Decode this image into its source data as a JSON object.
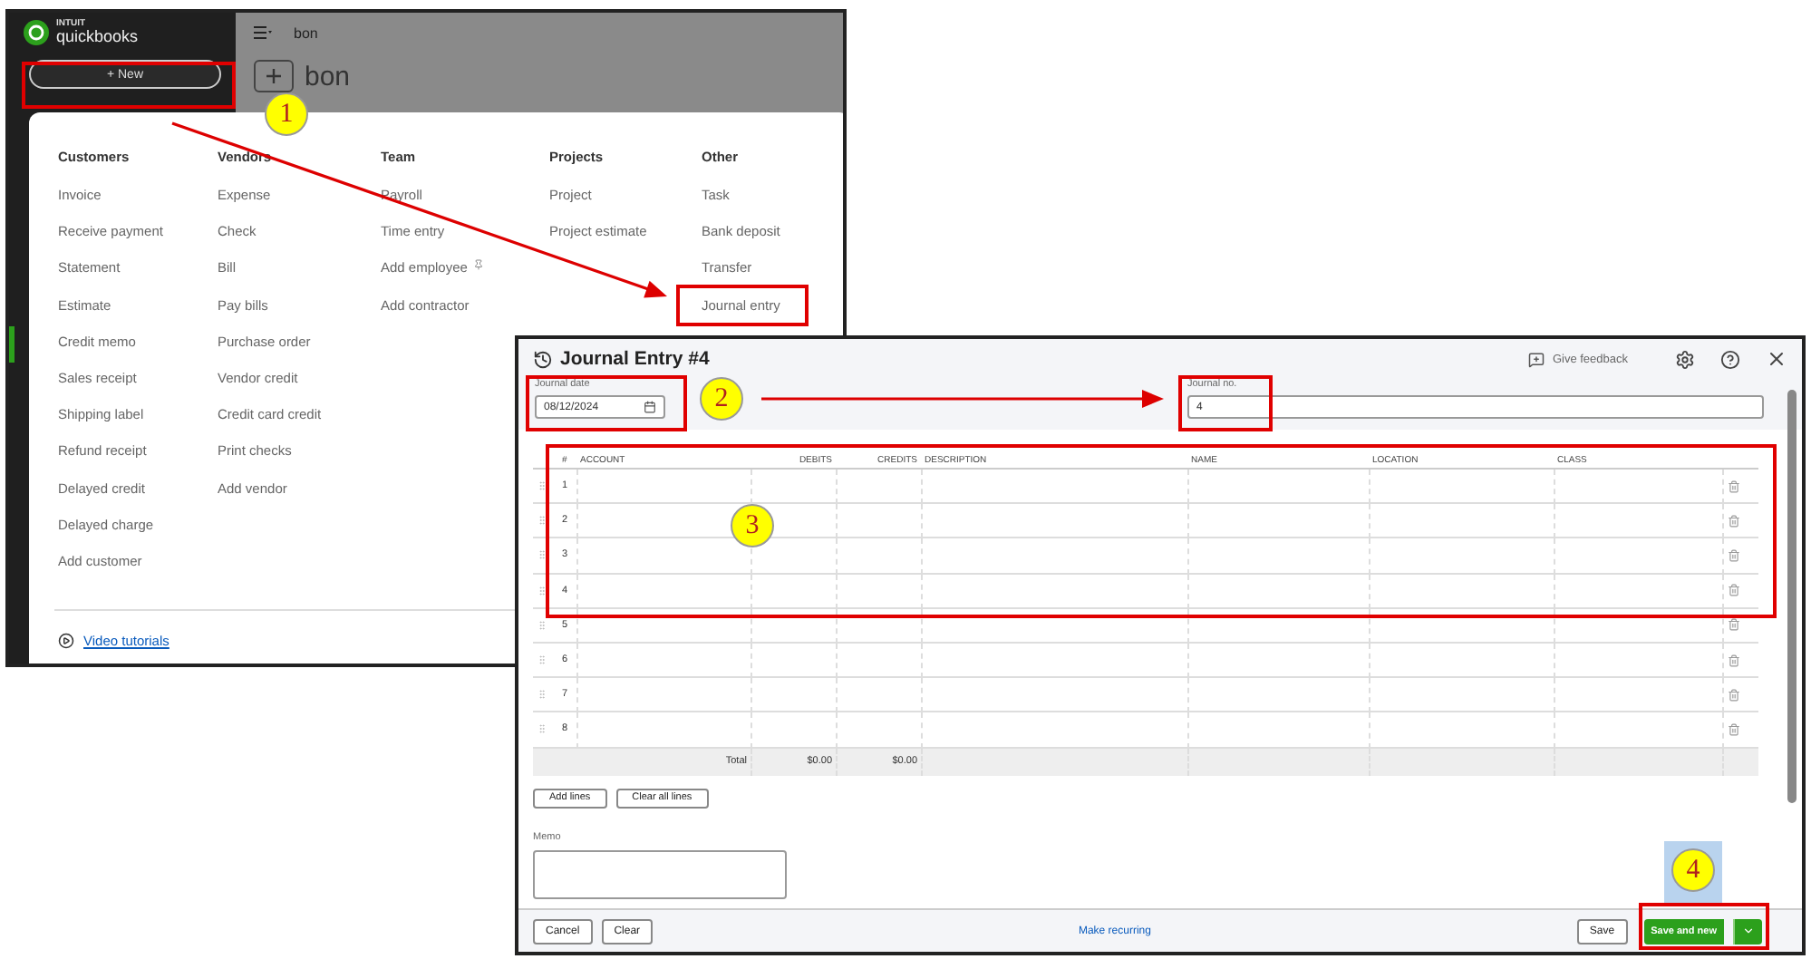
{
  "quickbooks_window": {
    "brand_small": "INTUIT",
    "brand": "quickbooks",
    "new_button": "+ New",
    "topbar_title": "bon",
    "page_title": "bon",
    "menu": {
      "columns": [
        {
          "heading": "Customers",
          "items": [
            "Invoice",
            "Receive payment",
            "Statement",
            "Estimate",
            "Credit memo",
            "Sales receipt",
            "Shipping label",
            "Refund receipt",
            "Delayed credit",
            "Delayed charge",
            "Add customer"
          ]
        },
        {
          "heading": "Vendors",
          "items": [
            "Expense",
            "Check",
            "Bill",
            "Pay bills",
            "Purchase order",
            "Vendor credit",
            "Credit card credit",
            "Print checks",
            "Add vendor"
          ]
        },
        {
          "heading": "Team",
          "items": [
            "Payroll",
            "Time entry",
            "Add employee",
            "Add contractor"
          ]
        },
        {
          "heading": "Projects",
          "items": [
            "Project",
            "Project estimate"
          ]
        },
        {
          "heading": "Other",
          "items": [
            "Task",
            "Bank deposit",
            "Transfer",
            "Journal entry"
          ]
        }
      ],
      "footer_link": "Video tutorials"
    }
  },
  "journal_window": {
    "title": "Journal Entry #4",
    "give_feedback": "Give feedback",
    "journal_date": {
      "label": "Journal date",
      "value": "08/12/2024"
    },
    "journal_no": {
      "label": "Journal no.",
      "value": "4"
    },
    "table": {
      "columns": [
        "#",
        "ACCOUNT",
        "DEBITS",
        "CREDITS",
        "DESCRIPTION",
        "NAME",
        "LOCATION",
        "CLASS"
      ],
      "rows": [
        {
          "number": "1"
        },
        {
          "number": "2"
        },
        {
          "number": "3"
        },
        {
          "number": "4"
        },
        {
          "number": "5"
        },
        {
          "number": "6"
        },
        {
          "number": "7"
        },
        {
          "number": "8"
        }
      ],
      "total": {
        "label": "Total",
        "debits": "$0.00",
        "credits": "$0.00"
      }
    },
    "line_buttons": [
      "Add lines",
      "Clear all lines"
    ],
    "memo": {
      "label": "Memo"
    },
    "footer": {
      "cancel": "Cancel",
      "clear": "Clear",
      "make_recurring": "Make recurring",
      "save": "Save",
      "save_and_new": "Save and new"
    }
  },
  "annotations": [
    {
      "number": "1",
      "backdrop": false
    },
    {
      "number": "2",
      "backdrop": false
    },
    {
      "number": "3",
      "backdrop": false
    },
    {
      "number": "4",
      "backdrop": true
    }
  ]
}
